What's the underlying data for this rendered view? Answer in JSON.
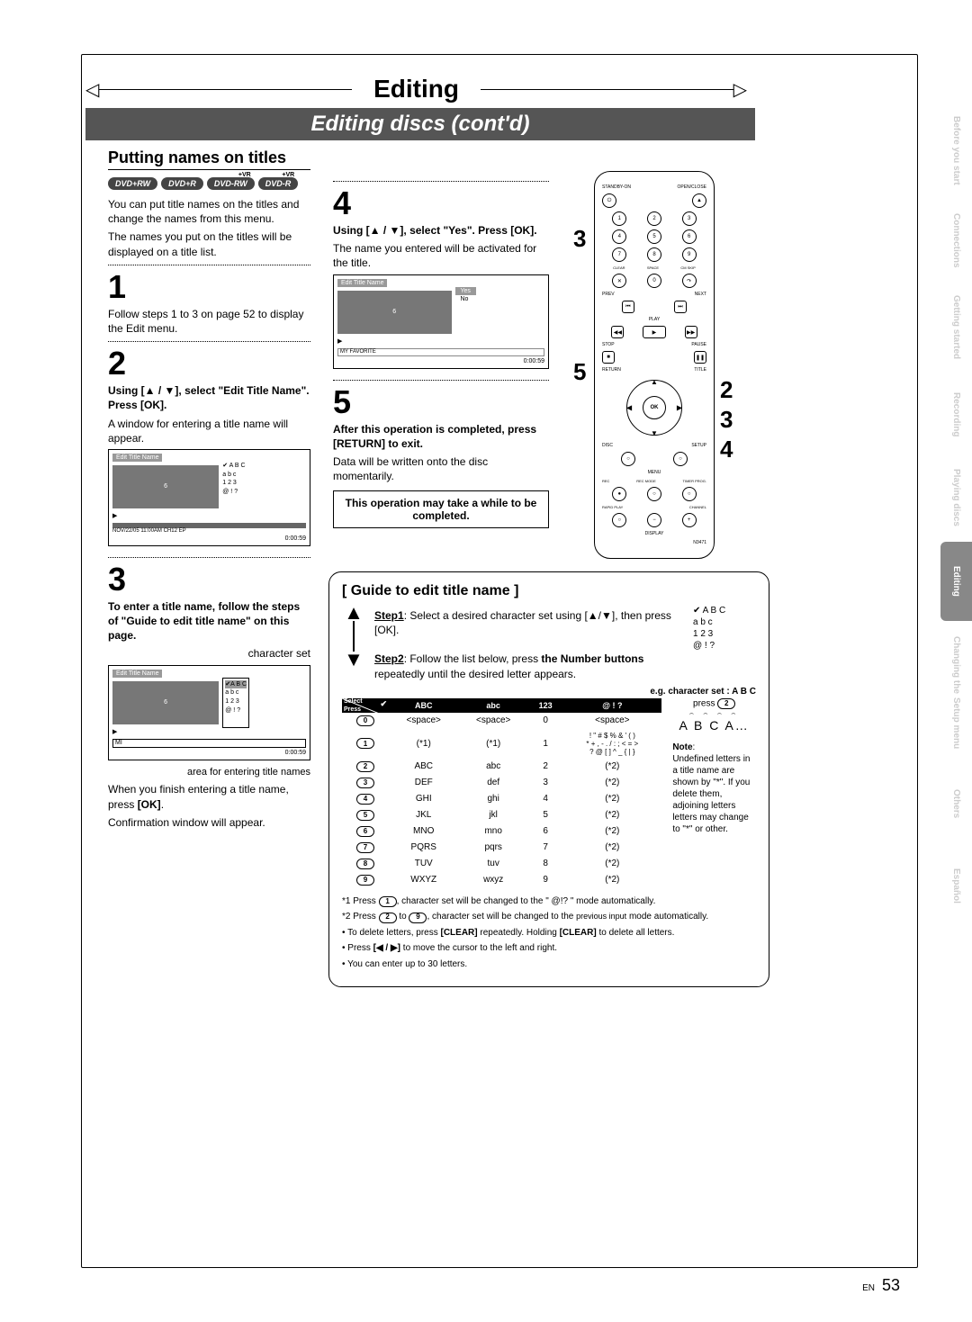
{
  "chapter": "Editing",
  "sectionBar": "Editing discs (cont'd)",
  "left": {
    "heading": "Putting names on titles",
    "discs": [
      "DVD+RW",
      "DVD+R",
      "DVD-RW",
      "DVD-R"
    ],
    "intro1": "You can put title names on the titles and change the names from this menu.",
    "intro2": "The names you put on the titles will be displayed on a title list.",
    "step1num": "1",
    "step1": "Follow steps 1 to 3 on page 52 to display the Edit menu.",
    "step2num": "2",
    "step2a": "Using [▲ / ▼], select \"Edit Title Name\". Press [OK].",
    "step2b": "A window for entering a title name will appear.",
    "osd1": {
      "title": "Edit Title Name",
      "badge": "6",
      "opts": [
        "✔ A B C",
        "a b c",
        "1 2 3",
        "@ ! ?"
      ],
      "date": "NOV/22/05 11:00AM CH12 EP",
      "time": "0:00:59"
    },
    "step3num": "3",
    "step3a": "To enter a title name, follow the steps of \"Guide to edit title name\" on this page.",
    "charsetLabel": "character set",
    "osd2": {
      "title": "Edit Title Name",
      "badge": "6",
      "opts": [
        "✔A B C",
        "a b c",
        "1 2 3",
        "@ ! ?"
      ],
      "entered": "MI",
      "time": "0:00:59"
    },
    "areaLabel": "area for entering title names",
    "step3b1": "When you finish entering a title name, press [OK].",
    "step3b2": "Confirmation window will appear."
  },
  "mid": {
    "step4num": "4",
    "step4a": "Using [▲ / ▼], select \"Yes\". Press [OK].",
    "step4b": "The name you entered will be activated for the title.",
    "osd3": {
      "title": "Edit Title Name",
      "badge": "6",
      "opts": [
        "Yes",
        "No"
      ],
      "fav": "MY FAVORITE",
      "time": "0:00:59"
    },
    "step5num": "5",
    "step5a": "After this operation is completed, press [RETURN] to exit.",
    "step5b": "Data will be written onto the disc momentarily.",
    "warn": "This operation may take a while to be completed."
  },
  "guide": {
    "title": "[ Guide to edit title name ]",
    "step1lbl": "Step1",
    "step1": ": Select a desired character set using [▲/▼], then press [OK].",
    "step1opts": [
      "✔   A B C",
      "a b c",
      "1 2 3",
      "@ ! ?"
    ],
    "step2lbl": "Step2",
    "step2a": ": Follow the list below, press ",
    "step2b": "the Number buttons",
    "step2c": " repeatedly until the desired letter appears.",
    "eglabel": "e.g. character set :  A B C",
    "press": "press",
    "pressnum": "2",
    "result": "A   B   C   A…",
    "noteHead": "Note",
    "note": "Undefined letters in a title name are shown by \"*\".  If you delete them, adjoining letters letters may change to \"*\" or other.",
    "tbl": {
      "h0": "Select",
      "h0b": "Press",
      "h1": "ABC",
      "h2": "abc",
      "h3": "123",
      "h4": "@ ! ?",
      "rows": [
        {
          "n": "0",
          "a": "<space>",
          "b": "<space>",
          "c": "0",
          "d": "<space>"
        },
        {
          "n": "1",
          "a": "(*1)",
          "b": "(*1)",
          "c": "1",
          "d": "! \" # $ % & ' ( )\n* + , - . / : ; < = >\n? @ [ ] ^ _ { | }"
        },
        {
          "n": "2",
          "a": "ABC",
          "b": "abc",
          "c": "2",
          "d": "(*2)"
        },
        {
          "n": "3",
          "a": "DEF",
          "b": "def",
          "c": "3",
          "d": "(*2)"
        },
        {
          "n": "4",
          "a": "GHI",
          "b": "ghi",
          "c": "4",
          "d": "(*2)"
        },
        {
          "n": "5",
          "a": "JKL",
          "b": "jkl",
          "c": "5",
          "d": "(*2)"
        },
        {
          "n": "6",
          "a": "MNO",
          "b": "mno",
          "c": "6",
          "d": "(*2)"
        },
        {
          "n": "7",
          "a": "PQRS",
          "b": "pqrs",
          "c": "7",
          "d": "(*2)"
        },
        {
          "n": "8",
          "a": "TUV",
          "b": "tuv",
          "c": "8",
          "d": "(*2)"
        },
        {
          "n": "9",
          "a": "WXYZ",
          "b": "wxyz",
          "c": "9",
          "d": "(*2)"
        }
      ]
    },
    "foot1a": "*1 Press ",
    "foot1b": ", character set will be changed to the \" @!? \" mode automatically.",
    "foot2a": "*2 Press ",
    "foot2b": " to ",
    "foot2c": ", character set will be changed to the ",
    "foot2d": "previous input",
    "foot2e": " mode automatically.",
    "bullet1": "To delete letters, press [CLEAR] repeatedly. Holding [CLEAR] to delete all letters.",
    "bullet2": "Press [◀ / ▶] to move the cursor to the left and right.",
    "bullet3": "You can enter up to 30 letters."
  },
  "sidebar": [
    "Before you start",
    "Connections",
    "Getting started",
    "Recording",
    "Playing discs",
    "Editing",
    "Changing the|Setup menu",
    "Others",
    "Español"
  ],
  "activeTab": 5,
  "page": {
    "lang": "EN",
    "num": "53"
  },
  "remote": {
    "model": "N3471",
    "ok": "OK",
    "display": "DISPLAY",
    "rapid": "RAPID PLAY",
    "channel": "CHANNEL",
    "rec": "REC",
    "recmode": "REC MODE",
    "timer": "TIMER PROG.",
    "menu": "MENU",
    "setup": "SETUP",
    "disc": "DISC",
    "title": "TITLE",
    "return": "RETURN",
    "prev": "PREV",
    "next": "NEXT",
    "play": "PLAY",
    "stop": "STOP",
    "pause": "PAUSE",
    "clear": "CLEAR",
    "space": "SPACE",
    "cmskip": "CM SKIP",
    "standby": "STANDBY-ON",
    "open": "OPEN/CLOSE"
  }
}
